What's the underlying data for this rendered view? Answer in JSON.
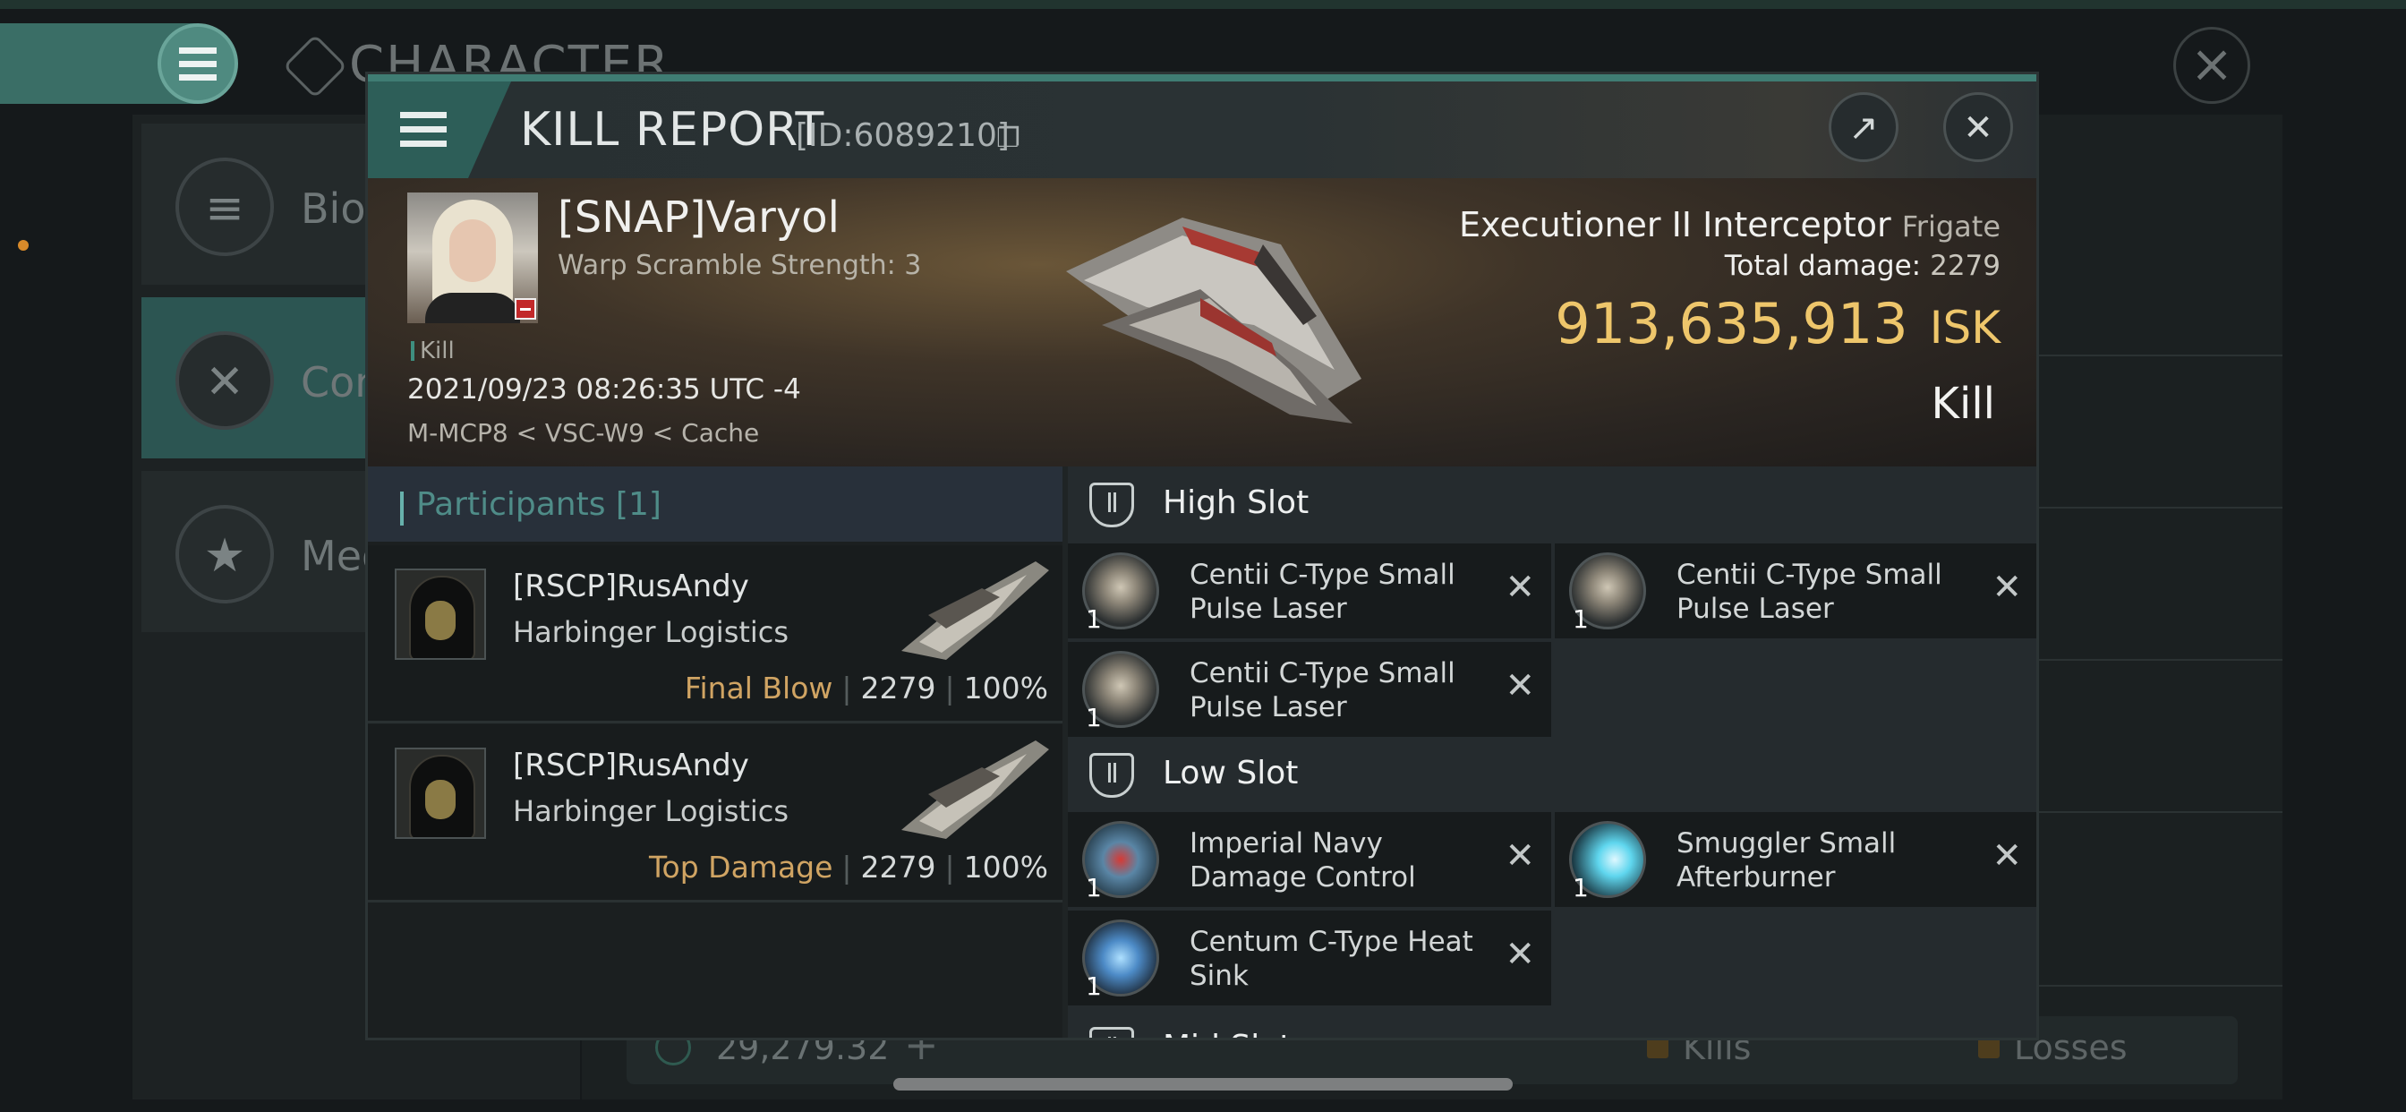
{
  "background": {
    "title": "CHARACTER",
    "sidebar": [
      {
        "label": "Bio",
        "icon": "menu-icon"
      },
      {
        "label": "Con",
        "icon": "crossed-swords-icon"
      },
      {
        "label": "Med",
        "icon": "star-medal-icon"
      }
    ],
    "isk_balance": "29,279.32",
    "legend": [
      "Kills",
      "Losses"
    ]
  },
  "modal": {
    "title": "KILL REPORT",
    "report_id": "[ID:6089210]",
    "victim": {
      "name": "[SNAP]Varyol",
      "subtitle": "Warp Scramble Strength: 3",
      "tag": "Kill",
      "datetime": "2021/09/23 08:26:35 UTC -4",
      "location": "M-MCP8 < VSC-W9 < Cache"
    },
    "ship": {
      "name": "Executioner II Interceptor",
      "class": "Frigate",
      "total_damage_label": "Total damage:",
      "total_damage": "2279",
      "isk_value": "913,635,913",
      "isk_unit": "ISK",
      "result": "Kill"
    },
    "participants": {
      "title": "Participants [1]",
      "rows": [
        {
          "name": "[RSCP]RusAndy",
          "ship": "Harbinger Logistics",
          "role": "Final Blow",
          "damage": "2279",
          "percent": "100%"
        },
        {
          "name": "[RSCP]RusAndy",
          "ship": "Harbinger Logistics",
          "role": "Top Damage",
          "damage": "2279",
          "percent": "100%"
        }
      ]
    },
    "fittings": {
      "high_slot": {
        "title": "High Slot",
        "modules": [
          {
            "name": "Centii C-Type Small Pulse Laser",
            "qty": "1"
          },
          {
            "name": "Centii C-Type Small Pulse Laser",
            "qty": "1"
          },
          {
            "name": "Centii C-Type Small Pulse Laser",
            "qty": "1"
          }
        ]
      },
      "low_slot": {
        "title": "Low Slot",
        "modules": [
          {
            "name": "Imperial Navy Damage Control",
            "qty": "1"
          },
          {
            "name": "Smuggler Small Afterburner",
            "qty": "1"
          },
          {
            "name": "Centum C-Type Heat Sink",
            "qty": "1"
          }
        ]
      },
      "mid_slot": {
        "title": "Mid Slot"
      }
    }
  }
}
